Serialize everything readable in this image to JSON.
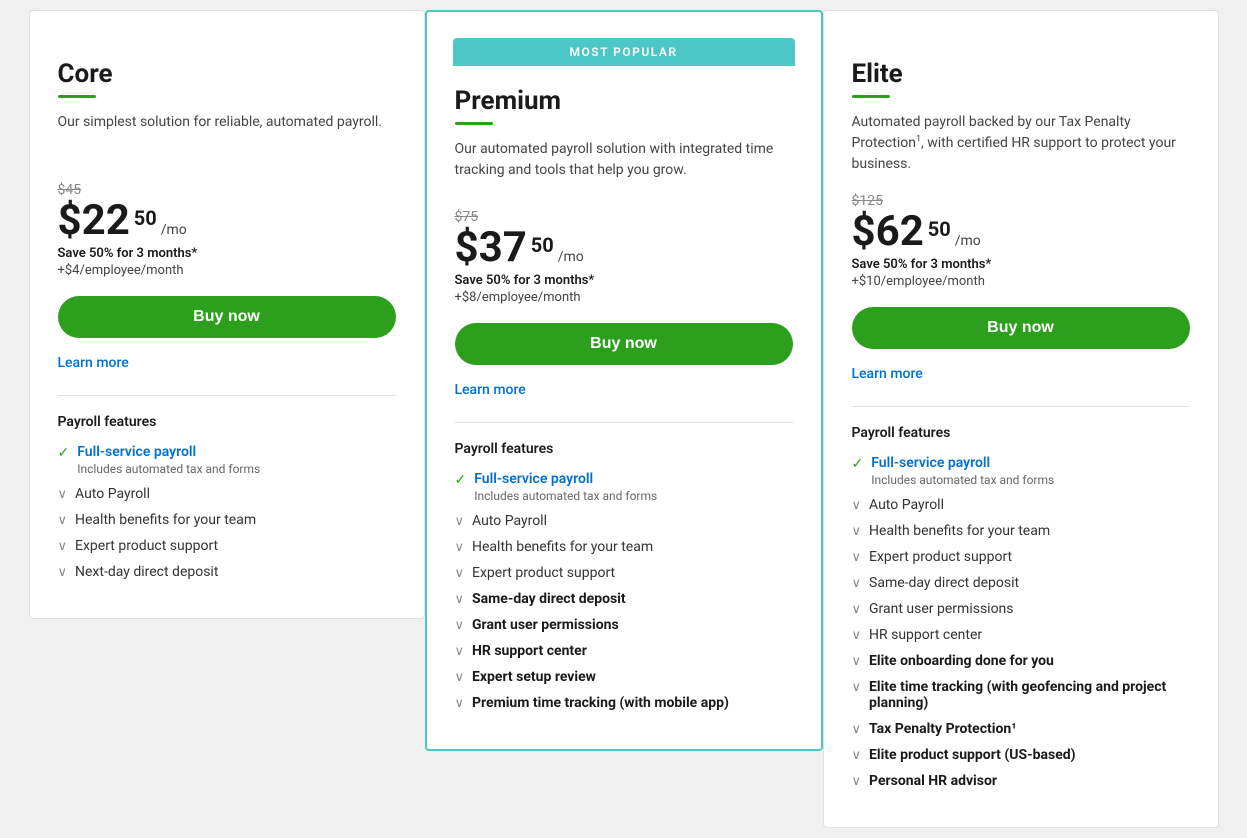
{
  "plans": [
    {
      "id": "core",
      "name": "Core",
      "popular": false,
      "description": "Our simplest solution for reliable, automated payroll.",
      "original_price": "$45",
      "price_dollar": "$22",
      "price_cents": "50",
      "price_period": "/mo",
      "save_text": "Save 50% for 3 months*",
      "per_employee": "+$4/employee/month",
      "buy_label": "Buy now",
      "learn_more": "Learn more",
      "features_heading": "Payroll features",
      "features": [
        {
          "type": "check",
          "label": "Full-service payroll",
          "sub": "Includes automated tax and forms",
          "bold": true
        },
        {
          "type": "chevron",
          "label": "Auto Payroll",
          "bold": false
        },
        {
          "type": "chevron",
          "label": "Health benefits for your team",
          "bold": false
        },
        {
          "type": "chevron",
          "label": "Expert product support",
          "bold": false
        },
        {
          "type": "chevron",
          "label": "Next-day direct deposit",
          "bold": false
        }
      ]
    },
    {
      "id": "premium",
      "name": "Premium",
      "popular": true,
      "popular_label": "MOST POPULAR",
      "description": "Our automated payroll solution with integrated time tracking and tools that help you grow.",
      "original_price": "$75",
      "price_dollar": "$37",
      "price_cents": "50",
      "price_period": "/mo",
      "save_text": "Save 50% for 3 months*",
      "per_employee": "+$8/employee/month",
      "buy_label": "Buy now",
      "learn_more": "Learn more",
      "features_heading": "Payroll features",
      "features": [
        {
          "type": "check",
          "label": "Full-service payroll",
          "sub": "Includes automated tax and forms",
          "bold": true
        },
        {
          "type": "chevron",
          "label": "Auto Payroll",
          "bold": false
        },
        {
          "type": "chevron",
          "label": "Health benefits for your team",
          "bold": false
        },
        {
          "type": "chevron",
          "label": "Expert product support",
          "bold": false
        },
        {
          "type": "chevron",
          "label": "Same-day direct deposit",
          "bold": true
        },
        {
          "type": "chevron",
          "label": "Grant user permissions",
          "bold": true
        },
        {
          "type": "chevron",
          "label": "HR support center",
          "bold": true
        },
        {
          "type": "chevron",
          "label": "Expert setup review",
          "bold": true
        },
        {
          "type": "chevron",
          "label": "Premium time tracking (with mobile app)",
          "bold": true
        }
      ]
    },
    {
      "id": "elite",
      "name": "Elite",
      "popular": false,
      "description_parts": [
        "Automated payroll backed by our Tax Penalty Protection",
        "1",
        ", with certified HR support to protect your business."
      ],
      "original_price": "$125",
      "price_dollar": "$62",
      "price_cents": "50",
      "price_period": "/mo",
      "save_text": "Save 50% for 3 months*",
      "per_employee": "+$10/employee/month",
      "buy_label": "Buy now",
      "learn_more": "Learn more",
      "features_heading": "Payroll features",
      "features": [
        {
          "type": "check",
          "label": "Full-service payroll",
          "sub": "Includes automated tax and forms",
          "bold": true
        },
        {
          "type": "chevron",
          "label": "Auto Payroll",
          "bold": false
        },
        {
          "type": "chevron",
          "label": "Health benefits for your team",
          "bold": false
        },
        {
          "type": "chevron",
          "label": "Expert product support",
          "bold": false
        },
        {
          "type": "chevron",
          "label": "Same-day direct deposit",
          "bold": false
        },
        {
          "type": "chevron",
          "label": "Grant user permissions",
          "bold": false
        },
        {
          "type": "chevron",
          "label": "HR support center",
          "bold": false
        },
        {
          "type": "chevron",
          "label": "Elite onboarding done for you",
          "bold": true
        },
        {
          "type": "chevron",
          "label": "Elite time tracking (with geofencing and project planning)",
          "bold": true
        },
        {
          "type": "chevron",
          "label": "Tax Penalty Protection¹",
          "bold": true
        },
        {
          "type": "chevron",
          "label": "Elite product support (US-based)",
          "bold": true
        },
        {
          "type": "chevron",
          "label": "Personal HR advisor",
          "bold": true
        }
      ]
    }
  ]
}
